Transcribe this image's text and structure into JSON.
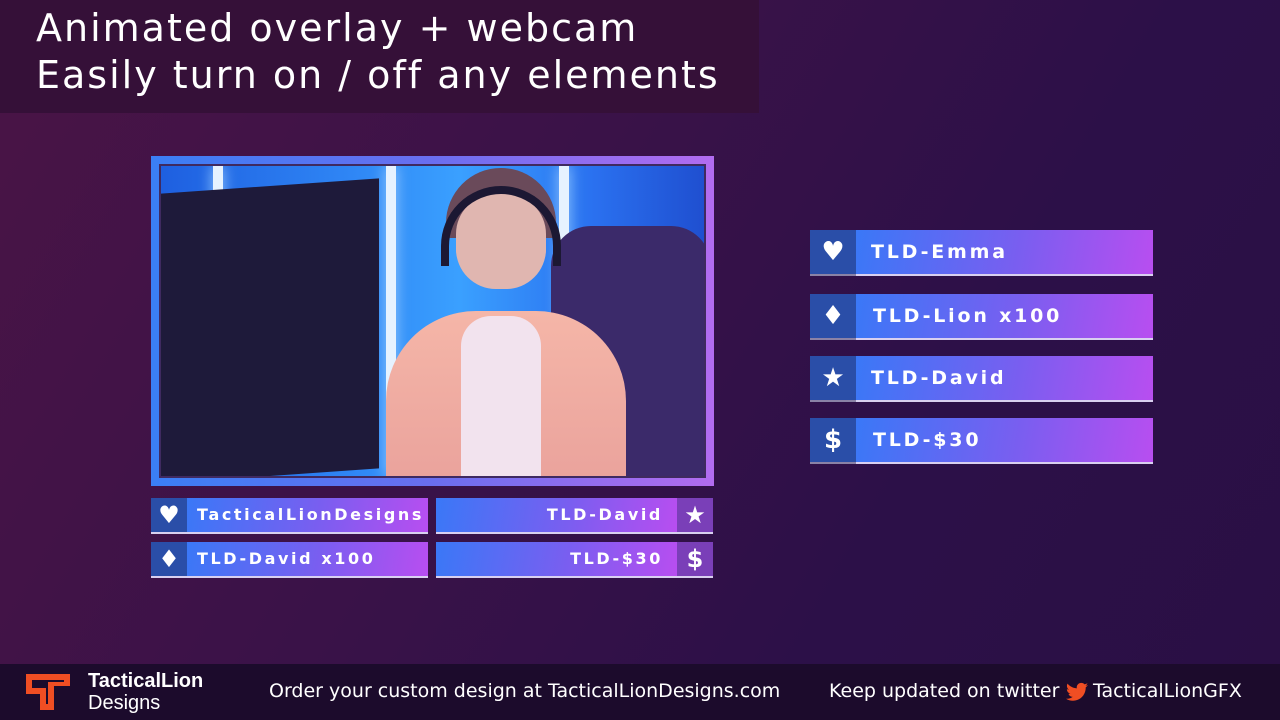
{
  "headline": {
    "line1": "Animated overlay + webcam",
    "line2": "Easily turn on / off any elements"
  },
  "webcam": {
    "image_description": "Smiling woman wearing a headset playing at a computer in a blue-lit gaming room"
  },
  "alerts": [
    {
      "icon": "heart-icon",
      "glyph": "♥",
      "label": "TLD-Emma"
    },
    {
      "icon": "diamond-icon",
      "glyph": "♦",
      "label": "TLD-Lion x100"
    },
    {
      "icon": "star-icon",
      "glyph": "★",
      "label": "TLD-David"
    },
    {
      "icon": "dollar-icon",
      "glyph": "$",
      "label": "TLD-$30"
    }
  ],
  "webcam_bars": {
    "left": [
      {
        "icon": "heart-icon",
        "glyph": "♥",
        "label": "TacticalLionDesigns"
      },
      {
        "icon": "diamond-icon",
        "glyph": "♦",
        "label": "TLD-David x100"
      }
    ],
    "right": [
      {
        "icon": "star-icon",
        "glyph": "★",
        "label": "TLD-David"
      },
      {
        "icon": "dollar-icon",
        "glyph": "$",
        "label": "TLD-$30"
      }
    ]
  },
  "footer": {
    "brand_line1": "TacticalLion",
    "brand_line2": "Designs",
    "order_text": "Order your custom design at TacticalLionDesigns.com",
    "twitter_text": "Keep updated on twitter",
    "twitter_handle": "TacticalLionGFX",
    "accent_color": "#f04e23"
  },
  "colors": {
    "bar_gradient_start": "#3a78f7",
    "bar_gradient_end": "#b84ef0",
    "icon_box": "#2a4ea8"
  }
}
